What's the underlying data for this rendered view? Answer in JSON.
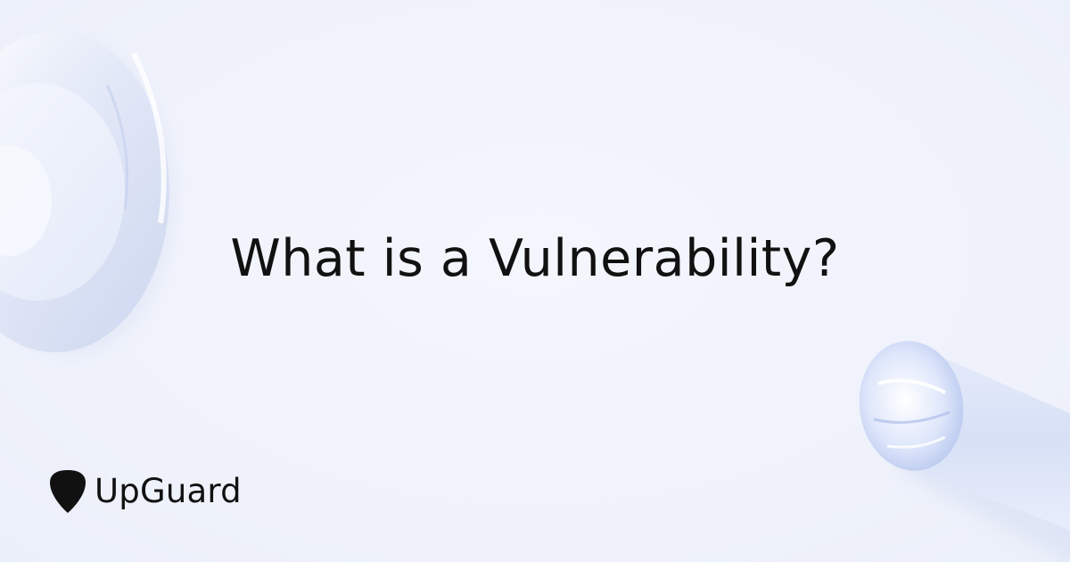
{
  "headline": "What is a Vulnerability?",
  "brand": {
    "name": "UpGuard",
    "icon": "guitar-pick-shield-icon"
  },
  "colors": {
    "background": "#f1f4fc",
    "text": "#111111"
  }
}
